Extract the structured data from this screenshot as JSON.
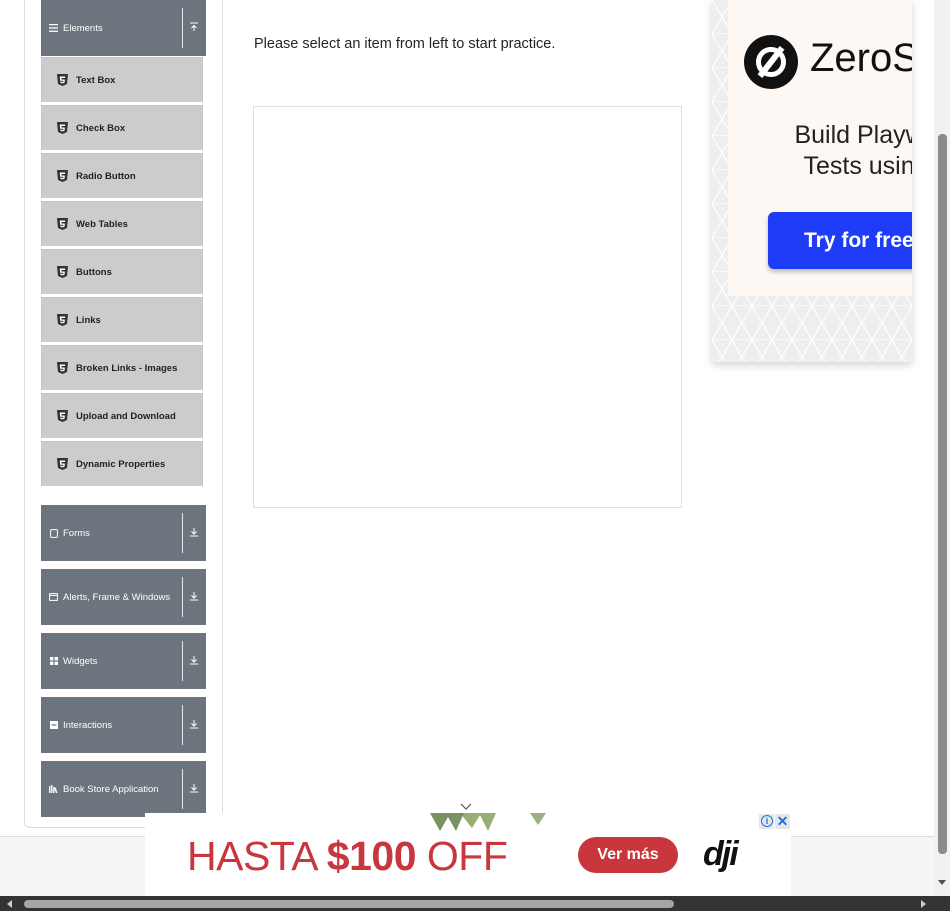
{
  "sidebar": {
    "elements_group": {
      "label": "Elements",
      "icon": "hamburger-icon",
      "state": "expanded"
    },
    "items": [
      {
        "label": "Text Box",
        "icon": "html5-icon"
      },
      {
        "label": "Check Box",
        "icon": "html5-icon"
      },
      {
        "label": "Radio Button",
        "icon": "html5-icon"
      },
      {
        "label": "Web Tables",
        "icon": "html5-icon"
      },
      {
        "label": "Buttons",
        "icon": "html5-icon"
      },
      {
        "label": "Links",
        "icon": "html5-icon"
      },
      {
        "label": "Broken Links - Images",
        "icon": "html5-icon"
      },
      {
        "label": "Upload and Download",
        "icon": "html5-icon"
      },
      {
        "label": "Dynamic Properties",
        "icon": "html5-icon"
      }
    ],
    "groups": [
      {
        "label": "Forms",
        "icon": "form-icon"
      },
      {
        "label": "Alerts, Frame & Windows",
        "icon": "window-icon"
      },
      {
        "label": "Widgets",
        "icon": "grid-icon"
      },
      {
        "label": "Interactions",
        "icon": "interactions-icon"
      },
      {
        "label": "Book Store Application",
        "icon": "books-icon"
      }
    ]
  },
  "main": {
    "instruction": "Please select an item from left to start practice."
  },
  "side_ad": {
    "brand": "ZeroSt",
    "headline_line1": "Build Playwri",
    "headline_line2": "Tests using",
    "cta": "Try for free →"
  },
  "bottom_ad": {
    "text_prefix": "HASTA ",
    "text_amount": "$100",
    "text_suffix": " OFF",
    "button": "Ver más",
    "brand": "dji",
    "info_glyph": "i",
    "close_glyph": "✕"
  },
  "colors": {
    "group_bg": "#6c757d",
    "item_bg": "#cccccc",
    "ad_red": "#c8373e",
    "cta_blue": "#1e3cf8"
  }
}
